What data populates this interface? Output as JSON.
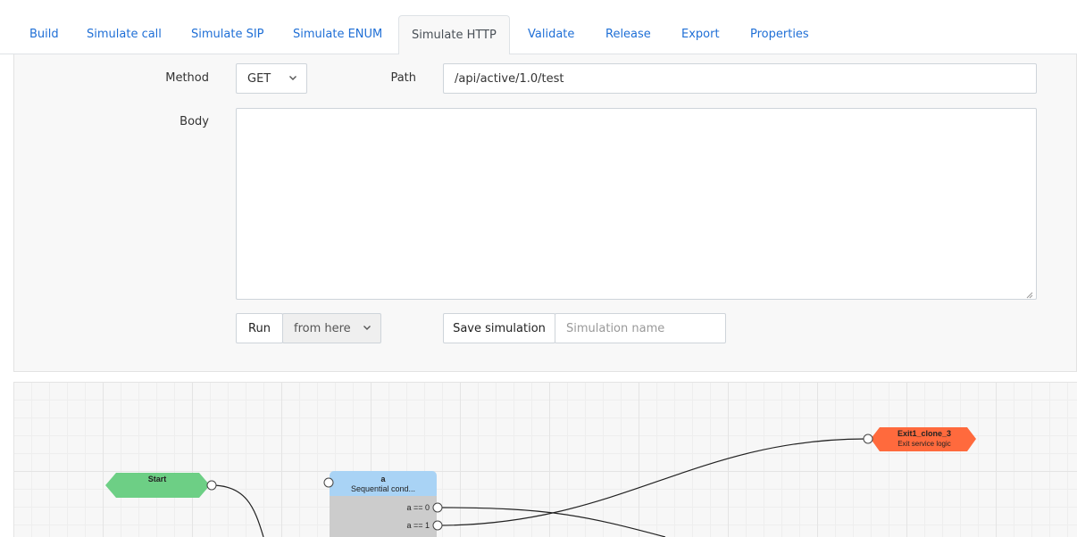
{
  "tabs": [
    {
      "label": "Build"
    },
    {
      "label": "Simulate call"
    },
    {
      "label": "Simulate SIP"
    },
    {
      "label": "Simulate ENUM"
    },
    {
      "label": "Simulate HTTP"
    },
    {
      "label": "Validate"
    },
    {
      "label": "Release"
    },
    {
      "label": "Export"
    },
    {
      "label": "Properties"
    }
  ],
  "form": {
    "method_label": "Method",
    "method_value": "GET",
    "path_label": "Path",
    "path_value": "/api/active/1.0/test",
    "body_label": "Body",
    "body_value": "",
    "run_label": "Run",
    "run_mode": "from here",
    "save_label": "Save simulation",
    "simulation_name_placeholder": "Simulation name"
  },
  "flow": {
    "start": {
      "title": "Start",
      "color": "#6dcf85"
    },
    "condition": {
      "title": "a",
      "subtitle": "Sequential cond...",
      "header_color": "#a9d3f5",
      "outputs": [
        "a == 0",
        "a == 1"
      ]
    },
    "exit": {
      "title": "Exit1_clone_3",
      "subtitle": "Exit service logic",
      "color": "#ff6a3d"
    }
  },
  "colors": {
    "accent": "#1f6fd6",
    "panel_bg": "#f8f8f8"
  }
}
